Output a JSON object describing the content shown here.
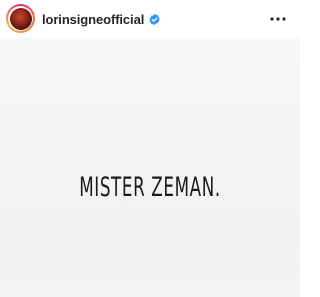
{
  "post": {
    "username": "lorinsigneofficial",
    "verified": true,
    "image_text": "MISTER ZEMAN."
  },
  "icons": {
    "verified": "verified-badge-icon",
    "more": "more-options-icon"
  },
  "colors": {
    "verified_blue": "#3897f0",
    "text_dark": "#262626",
    "image_background": "#f4f4f4"
  }
}
